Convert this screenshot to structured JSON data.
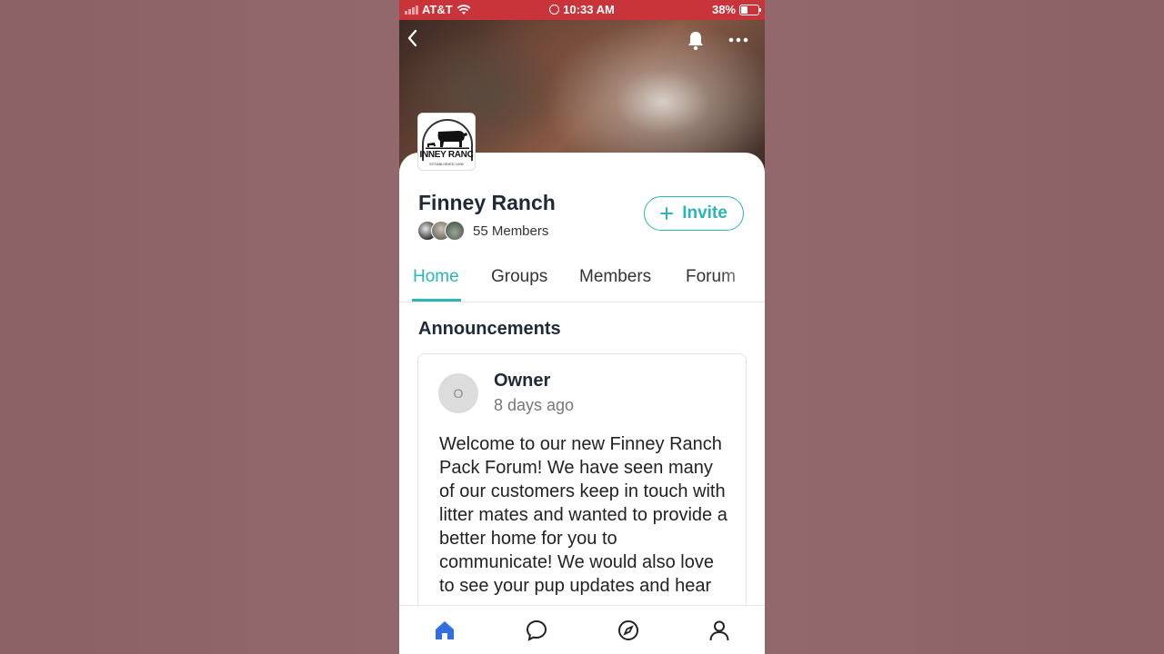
{
  "status_bar": {
    "carrier": "AT&T",
    "time": "10:33 AM",
    "battery": "38%",
    "battery_level": 0.38
  },
  "header": {
    "back_icon": "chevron-left-icon",
    "notifications_icon": "bell-icon",
    "more_icon": "more-horizontal-icon"
  },
  "group": {
    "logo_text": "INNEY RANC",
    "logo_subtext": "ESTABLISHED 1996",
    "name": "Finney Ranch",
    "members_label": "55 Members",
    "invite_label": "Invite"
  },
  "tabs": [
    {
      "label": "Home",
      "active": true
    },
    {
      "label": "Groups",
      "active": false
    },
    {
      "label": "Members",
      "active": false
    },
    {
      "label": "Forum",
      "active": false
    }
  ],
  "announcements": {
    "title": "Announcements",
    "post": {
      "avatar_initial": "O",
      "author": "Owner",
      "time": "8 days ago",
      "body": "Welcome to our new Finney Ranch Pack Forum! We have seen many of our customers keep in touch with litter mates and wanted to provide a better home for you to communicate! We would also love to see your pup updates and hear your"
    }
  },
  "bottom_nav": [
    {
      "icon": "home-icon",
      "active": true
    },
    {
      "icon": "chat-icon",
      "active": false
    },
    {
      "icon": "compass-icon",
      "active": false
    },
    {
      "icon": "profile-icon",
      "active": false
    }
  ],
  "colors": {
    "accent": "#2bb5b8",
    "status_bar": "#c9343a",
    "nav_active": "#2f6fe0",
    "background": "#8e6469"
  }
}
